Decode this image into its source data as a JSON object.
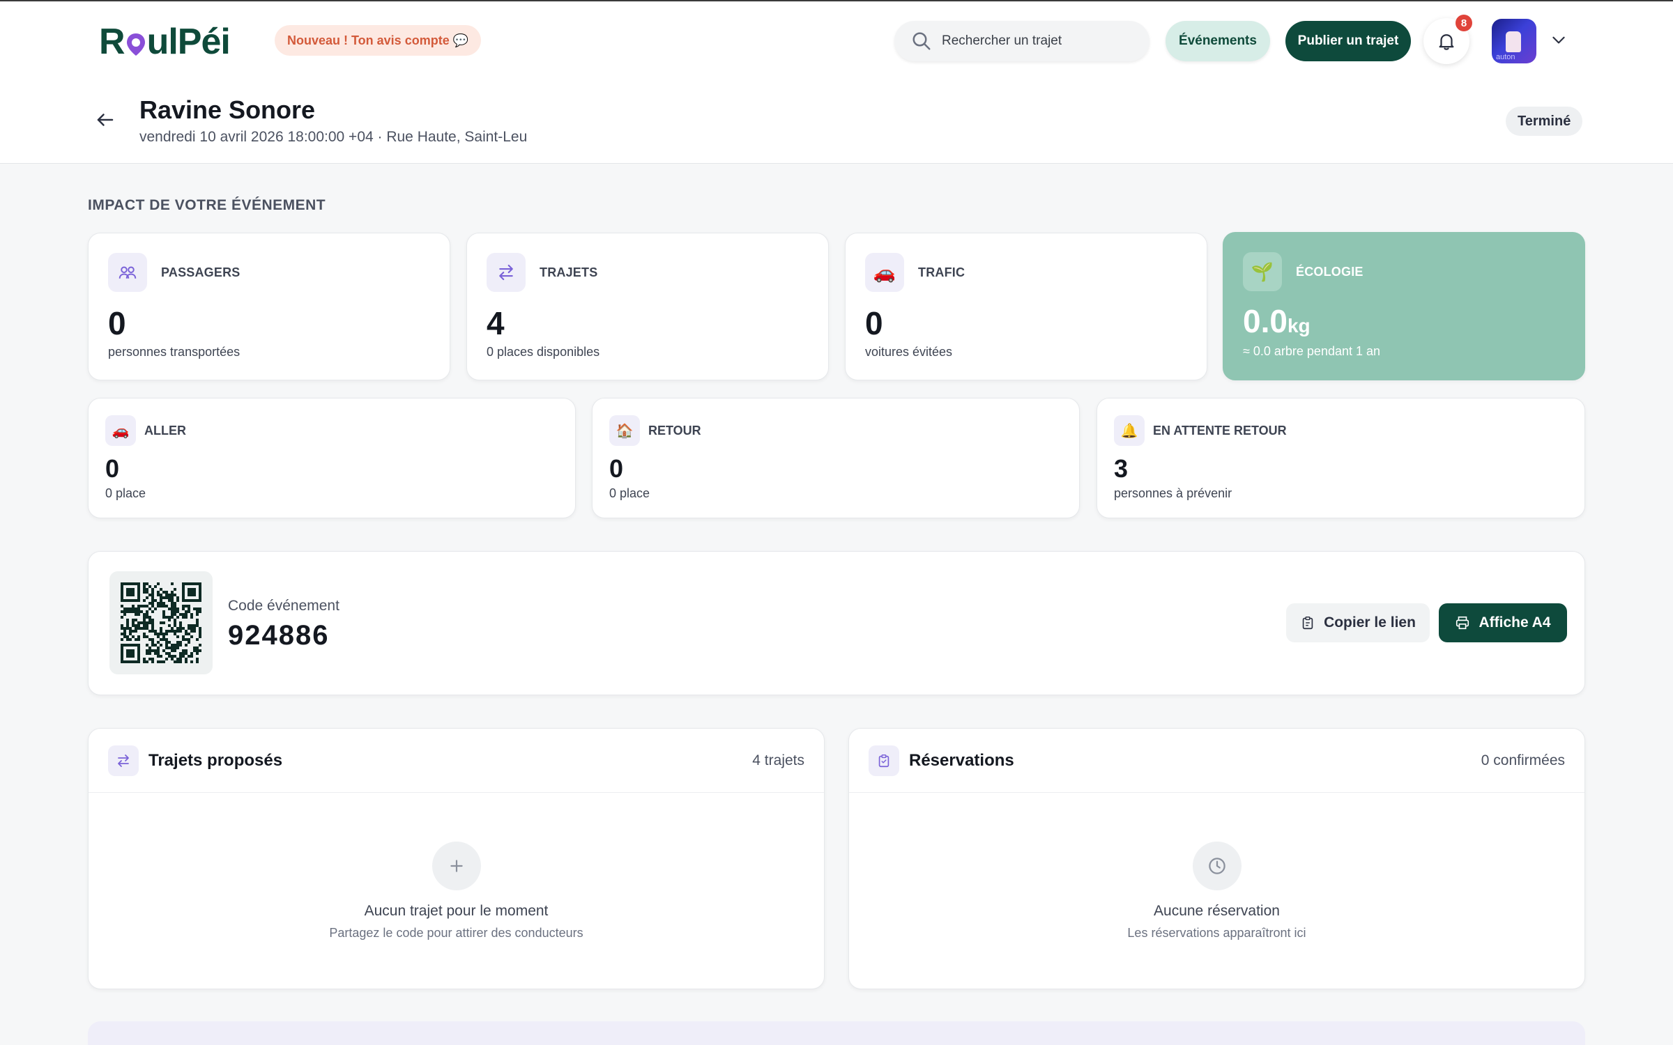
{
  "header": {
    "logo_text": "RoulPéi",
    "new_badge": "Nouveau ! Ton avis compte 💬",
    "search_placeholder": "Rechercher un trajet",
    "events_label": "Événements",
    "publish_label": "Publier un trajet",
    "notification_count": "8",
    "avatar_caption": "auton"
  },
  "event": {
    "title": "Ravine Sonore",
    "subtitle": "vendredi 10 avril 2026 18:00:00 +04 · Rue Haute, Saint-Leu",
    "status": "Terminé"
  },
  "impact": {
    "section_title": "IMPACT DE VOTRE ÉVÉNEMENT",
    "stats": [
      {
        "label": "PASSAGERS",
        "value": "0",
        "sub": "personnes transportées",
        "icon": "users-icon"
      },
      {
        "label": "TRAJETS",
        "value": "4",
        "sub": "0 places disponibles",
        "icon": "swap-arrows-icon"
      },
      {
        "label": "TRAFIC",
        "value": "0",
        "sub": "voitures évitées",
        "icon": "car-icon"
      },
      {
        "label": "ÉCOLOGIE",
        "value": "0.0",
        "unit": "kg",
        "sub": "≈ 0.0 arbre pendant 1 an",
        "icon": "seedling-icon"
      }
    ],
    "trips": [
      {
        "label": "ALLER",
        "value": "0",
        "sub": "0 place",
        "icon": "car-icon"
      },
      {
        "label": "RETOUR",
        "value": "0",
        "sub": "0 place",
        "icon": "house-icon"
      },
      {
        "label": "EN ATTENTE RETOUR",
        "value": "3",
        "sub": "personnes à prévenir",
        "icon": "bell-icon"
      }
    ]
  },
  "code": {
    "label": "Code événement",
    "value": "924886",
    "copy_label": "Copier le lien",
    "print_label": "Affiche A4"
  },
  "panels": {
    "trips": {
      "title": "Trajets proposés",
      "count": "4 trajets",
      "empty_title": "Aucun trajet pour le moment",
      "empty_sub": "Partagez le code pour attirer des conducteurs"
    },
    "reservations": {
      "title": "Réservations",
      "count": "0 confirmées",
      "empty_title": "Aucune réservation",
      "empty_sub": "Les réservations apparaîtront ici"
    }
  },
  "colors": {
    "brand": "#0e4a3c",
    "eco_card": "#8fc5b2",
    "badge_bg": "#fde9e2",
    "badge_text": "#d35a3a",
    "notification": "#e0433a"
  }
}
